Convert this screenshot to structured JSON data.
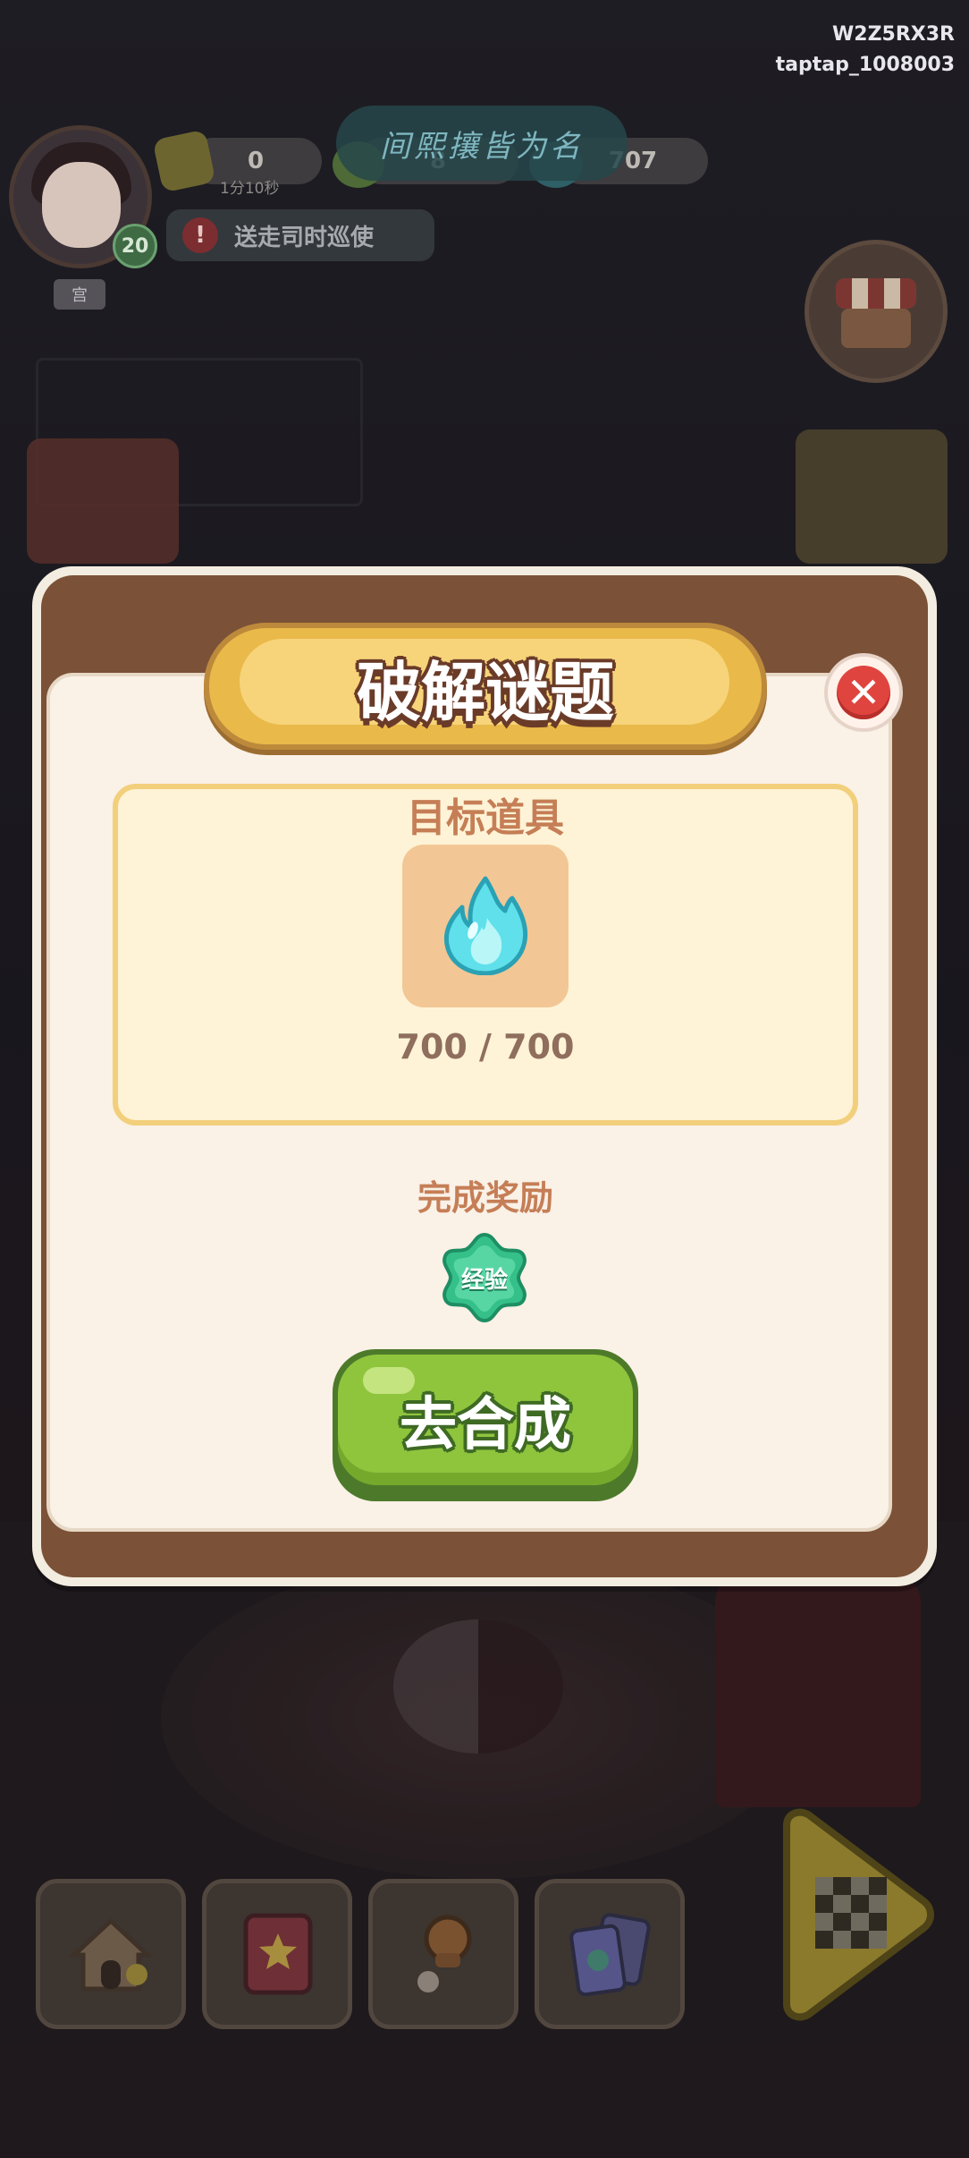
{
  "watermark": {
    "line1": "W2Z5RX3R",
    "line2": "taptap_1008003"
  },
  "hud": {
    "player_level": "20",
    "player_name_tag": "宫",
    "energy_value": "0",
    "energy_timer": "1分10秒",
    "coin_value": "8",
    "gem_value": "707",
    "scene_title": "间熙攘皆为名",
    "quest_text": "送走司时巡使",
    "quest_alert": "!"
  },
  "dialog": {
    "title": "破解谜题",
    "close_symbol": "✕",
    "target_label": "目标道具",
    "target_item_icon": "blue-flame-icon",
    "progress": "700 / 700",
    "progress_current": 700,
    "progress_total": 700,
    "reward_label": "完成奖励",
    "reward_badge": "经验",
    "action_button": "去合成"
  },
  "bottom_nav": [
    "home-icon",
    "book-icon",
    "pin-icon",
    "cards-icon",
    "play-board-icon"
  ],
  "colors": {
    "title_ribbon": "#e9b94a",
    "frame_brown": "#7b5237",
    "paper": "#faf1e7",
    "target_box": "#fef3d6",
    "label_orange": "#c57e56",
    "button_green": "#8fc53d",
    "close_red": "#e0443f",
    "exp_green": "#35c08a",
    "flame_cyan": "#5fe0ea"
  }
}
